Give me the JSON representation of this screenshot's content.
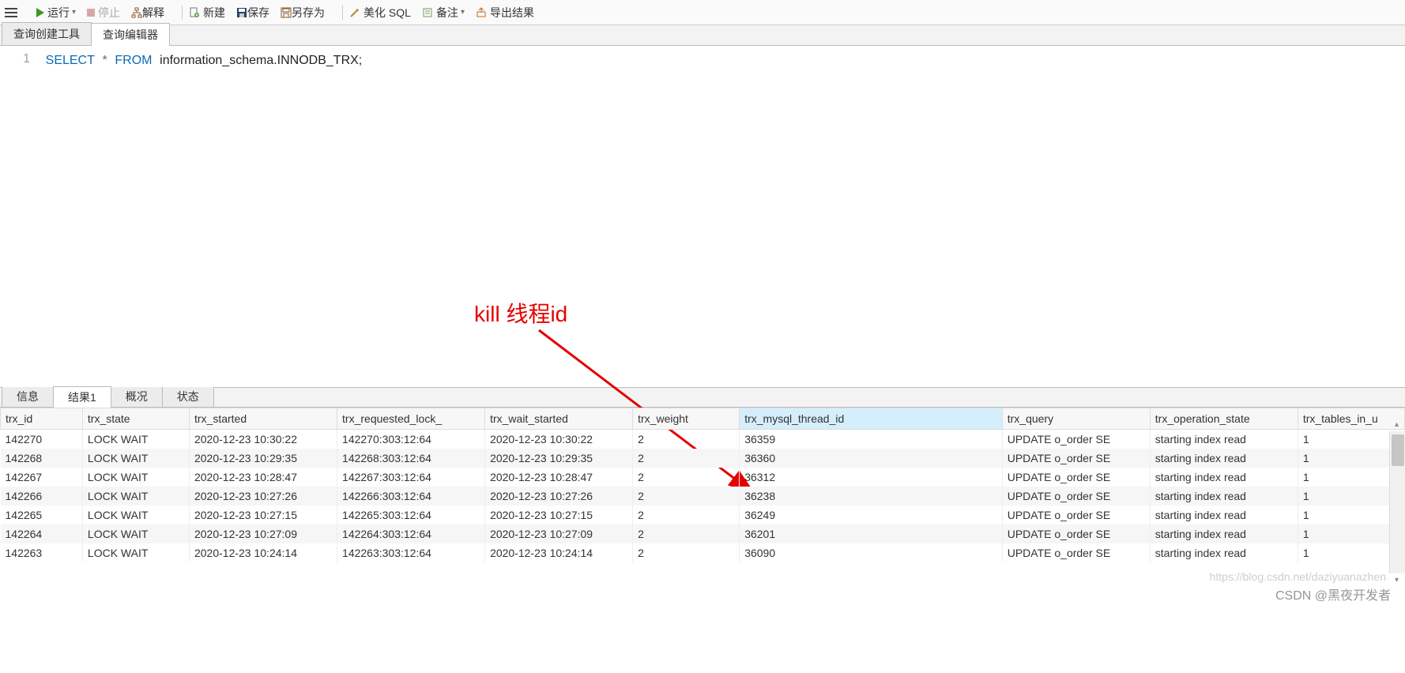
{
  "toolbar": {
    "run": "运行",
    "stop": "停止",
    "explain": "解释",
    "new": "新建",
    "save": "保存",
    "saveas": "另存为",
    "beautify": "美化 SQL",
    "remark": "备注",
    "export": "导出结果"
  },
  "top_tabs": {
    "creator": "查询创建工具",
    "editor": "查询编辑器"
  },
  "editor": {
    "line_no": "1",
    "kw_select": "SELECT",
    "kw_star": "*",
    "kw_from": "FROM",
    "stmt_rest": "information_schema.INNODB_TRX;"
  },
  "annotation": {
    "text": "kill 线程id"
  },
  "result_tabs": {
    "info": "信息",
    "result1": "结果1",
    "profile": "概况",
    "status": "状态"
  },
  "columns": {
    "trx_id": "trx_id",
    "trx_state": "trx_state",
    "trx_started": "trx_started",
    "trx_requested_lock": "trx_requested_lock_",
    "trx_wait_started": "trx_wait_started",
    "trx_weight": "trx_weight",
    "trx_mysql_thread_id": "trx_mysql_thread_id",
    "trx_query": "trx_query",
    "trx_operation_state": "trx_operation_state",
    "trx_tables_in_u": "trx_tables_in_u"
  },
  "rows": [
    {
      "trx_id": "142270",
      "trx_state": "LOCK WAIT",
      "trx_started": "2020-12-23 10:30:22",
      "trx_requested_lock": "142270:303:12:64",
      "trx_wait_started": "2020-12-23 10:30:22",
      "trx_weight": "2",
      "trx_mysql_thread_id": "36359",
      "trx_query": "UPDATE o_order  SE",
      "trx_operation_state": "starting index read",
      "trx_tables_in_u": "1"
    },
    {
      "trx_id": "142268",
      "trx_state": "LOCK WAIT",
      "trx_started": "2020-12-23 10:29:35",
      "trx_requested_lock": "142268:303:12:64",
      "trx_wait_started": "2020-12-23 10:29:35",
      "trx_weight": "2",
      "trx_mysql_thread_id": "36360",
      "trx_query": "UPDATE o_order  SE",
      "trx_operation_state": "starting index read",
      "trx_tables_in_u": "1"
    },
    {
      "trx_id": "142267",
      "trx_state": "LOCK WAIT",
      "trx_started": "2020-12-23 10:28:47",
      "trx_requested_lock": "142267:303:12:64",
      "trx_wait_started": "2020-12-23 10:28:47",
      "trx_weight": "2",
      "trx_mysql_thread_id": "36312",
      "trx_query": "UPDATE o_order  SE",
      "trx_operation_state": "starting index read",
      "trx_tables_in_u": "1"
    },
    {
      "trx_id": "142266",
      "trx_state": "LOCK WAIT",
      "trx_started": "2020-12-23 10:27:26",
      "trx_requested_lock": "142266:303:12:64",
      "trx_wait_started": "2020-12-23 10:27:26",
      "trx_weight": "2",
      "trx_mysql_thread_id": "36238",
      "trx_query": "UPDATE o_order  SE",
      "trx_operation_state": "starting index read",
      "trx_tables_in_u": "1"
    },
    {
      "trx_id": "142265",
      "trx_state": "LOCK WAIT",
      "trx_started": "2020-12-23 10:27:15",
      "trx_requested_lock": "142265:303:12:64",
      "trx_wait_started": "2020-12-23 10:27:15",
      "trx_weight": "2",
      "trx_mysql_thread_id": "36249",
      "trx_query": "UPDATE o_order  SE",
      "trx_operation_state": "starting index read",
      "trx_tables_in_u": "1"
    },
    {
      "trx_id": "142264",
      "trx_state": "LOCK WAIT",
      "trx_started": "2020-12-23 10:27:09",
      "trx_requested_lock": "142264:303:12:64",
      "trx_wait_started": "2020-12-23 10:27:09",
      "trx_weight": "2",
      "trx_mysql_thread_id": "36201",
      "trx_query": "UPDATE o_order  SE",
      "trx_operation_state": "starting index read",
      "trx_tables_in_u": "1"
    },
    {
      "trx_id": "142263",
      "trx_state": "LOCK WAIT",
      "trx_started": "2020-12-23 10:24:14",
      "trx_requested_lock": "142263:303:12:64",
      "trx_wait_started": "2020-12-23 10:24:14",
      "trx_weight": "2",
      "trx_mysql_thread_id": "36090",
      "trx_query": "UPDATE o_order  SE",
      "trx_operation_state": "starting index read",
      "trx_tables_in_u": "1"
    }
  ],
  "watermark": "https://blog.csdn.net/daziyuanazhen",
  "credit": "CSDN @黑夜开发者"
}
